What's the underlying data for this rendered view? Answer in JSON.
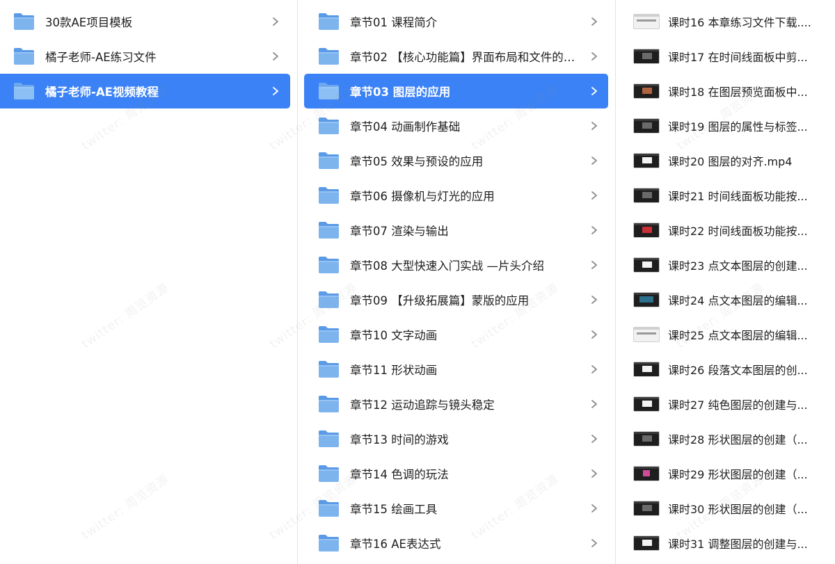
{
  "columns": [
    {
      "items": [
        {
          "label": "30款AE项目模板",
          "selected": false
        },
        {
          "label": "橘子老师-AE练习文件",
          "selected": false
        },
        {
          "label": "橘子老师-AE视频教程",
          "selected": true
        }
      ]
    },
    {
      "items": [
        {
          "label": "章节01 课程简介",
          "selected": false
        },
        {
          "label": "章节02 【核心功能篇】界面布局和文件的基...",
          "selected": false
        },
        {
          "label": "章节03 图层的应用",
          "selected": true
        },
        {
          "label": "章节04 动画制作基础",
          "selected": false
        },
        {
          "label": "章节05 效果与预设的应用",
          "selected": false
        },
        {
          "label": "章节06 摄像机与灯光的应用",
          "selected": false
        },
        {
          "label": "章节07 渲染与输出",
          "selected": false
        },
        {
          "label": "章节08 大型快速入门实战 —片头介绍",
          "selected": false
        },
        {
          "label": "章节09 【升级拓展篇】蒙版的应用",
          "selected": false
        },
        {
          "label": "章节10 文字动画",
          "selected": false
        },
        {
          "label": "章节11 形状动画",
          "selected": false
        },
        {
          "label": "章节12 运动追踪与镜头稳定",
          "selected": false
        },
        {
          "label": "章节13 时间的游戏",
          "selected": false
        },
        {
          "label": "章节14 色调的玩法",
          "selected": false
        },
        {
          "label": "章节15 绘画工具",
          "selected": false
        },
        {
          "label": "章节16 AE表达式",
          "selected": false
        }
      ]
    },
    {
      "items": [
        {
          "label": "课时16 本章练习文件下载....",
          "thumb": "light"
        },
        {
          "label": "课时17 在时间线面板中剪...",
          "thumb": "dark"
        },
        {
          "label": "课时18 在图层预览面板中...",
          "thumb": "warm"
        },
        {
          "label": "课时19 图层的属性与标签...",
          "thumb": "dark"
        },
        {
          "label": "课时20 图层的对齐.mp4",
          "thumb": "white"
        },
        {
          "label": "课时21 时间线面板功能按...",
          "thumb": "dark"
        },
        {
          "label": "课时22 时间线面板功能按...",
          "thumb": "red"
        },
        {
          "label": "课时23 点文本图层的创建...",
          "thumb": "white"
        },
        {
          "label": "课时24 点文本图层的编辑...",
          "thumb": "text"
        },
        {
          "label": "课时25 点文本图层的编辑...",
          "thumb": "light"
        },
        {
          "label": "课时26 段落文本图层的创...",
          "thumb": "white"
        },
        {
          "label": "课时27 纯色图层的创建与...",
          "thumb": "white"
        },
        {
          "label": "课时28 形状图层的创建（...",
          "thumb": "dark"
        },
        {
          "label": "课时29 形状图层的创建（...",
          "thumb": "pink"
        },
        {
          "label": "课时30 形状图层的创建（...",
          "thumb": "dark"
        },
        {
          "label": "课时31 调整图层的创建与...",
          "thumb": "white"
        }
      ]
    }
  ],
  "watermark_text": "twitter: 周览资源",
  "colors": {
    "selection": "#3b82f6",
    "folder_body": "#7db4ee",
    "folder_tab": "#5a9ae6"
  }
}
